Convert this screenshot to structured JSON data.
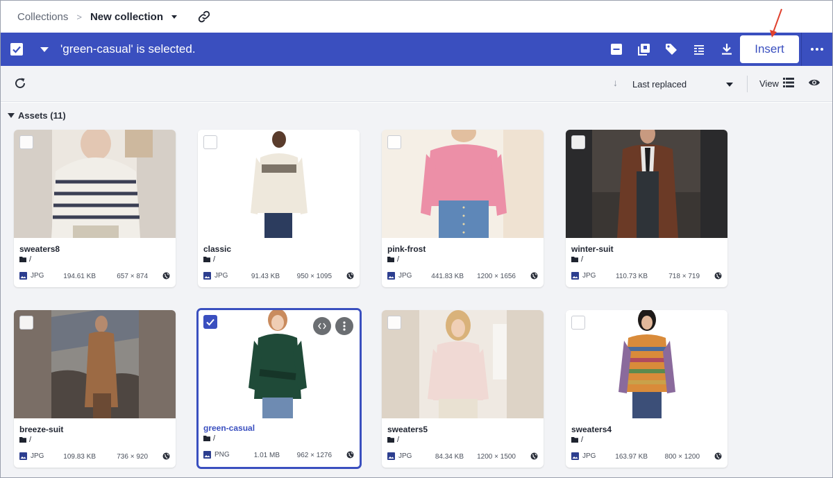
{
  "breadcrumb": {
    "parent": "Collections",
    "separator": ">",
    "current": "New collection"
  },
  "selection_bar": {
    "message": "'green-casual' is selected.",
    "insert_label": "Insert",
    "color": "#3a4fbf"
  },
  "toolbar": {
    "sort_label": "Last replaced",
    "view_label": "View"
  },
  "assets": {
    "header": "Assets (11)",
    "folder_path": "/",
    "items": [
      {
        "name": "sweaters8",
        "type": "JPG",
        "size": "194.61 KB",
        "dims": "657 × 874",
        "selected": false
      },
      {
        "name": "classic",
        "type": "JPG",
        "size": "91.43 KB",
        "dims": "950 × 1095",
        "selected": false
      },
      {
        "name": "pink-frost",
        "type": "JPG",
        "size": "441.83 KB",
        "dims": "1200 × 1656",
        "selected": false
      },
      {
        "name": "winter-suit",
        "type": "JPG",
        "size": "110.73 KB",
        "dims": "718 × 719",
        "selected": false
      },
      {
        "name": "breeze-suit",
        "type": "JPG",
        "size": "109.83 KB",
        "dims": "736 × 920",
        "selected": false
      },
      {
        "name": "green-casual",
        "type": "PNG",
        "size": "1.01 MB",
        "dims": "962 × 1276",
        "selected": true
      },
      {
        "name": "sweaters5",
        "type": "JPG",
        "size": "84.34 KB",
        "dims": "1200 × 1500",
        "selected": false
      },
      {
        "name": "sweaters4",
        "type": "JPG",
        "size": "163.97 KB",
        "dims": "800 × 1200",
        "selected": false
      }
    ]
  },
  "icons": {
    "link": "link-icon",
    "select_all": "checkbox-checked-icon",
    "deselect": "minus-square-icon",
    "copy": "copy-icon",
    "tag": "tag-icon",
    "list": "list-icon",
    "download": "download-icon",
    "more": "more-horizontal-icon",
    "refresh": "refresh-icon",
    "view": "list-view-icon",
    "preview": "eye-icon",
    "image": "image-icon",
    "folder": "folder-icon",
    "globe": "globe-icon",
    "embed": "code-icon",
    "card_more": "more-vertical-icon"
  }
}
